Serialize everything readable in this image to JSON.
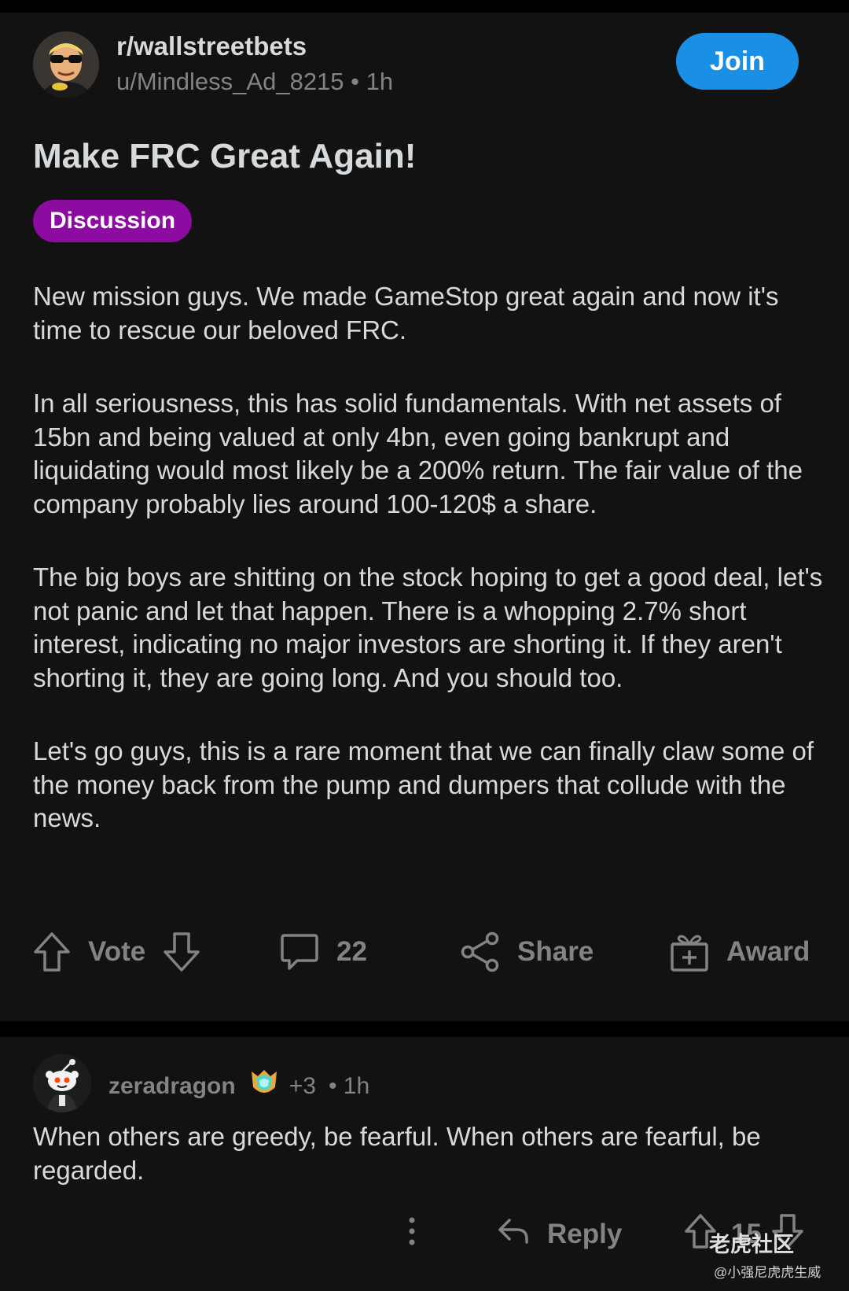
{
  "post": {
    "subreddit": "r/wallstreetbets",
    "author_line": "u/Mindless_Ad_8215 • 1h",
    "join_label": "Join",
    "title": "Make FRC Great Again!",
    "flair": "Discussion",
    "flair_color": "#8c0ba0",
    "paragraphs": [
      "New mission guys. We made GameStop great again and now it's time to rescue our beloved FRC.",
      "In all seriousness, this has solid fundamentals. With net assets of 15bn and being valued at only 4bn, even going bankrupt and liquidating would most likely be a 200% return. The fair value of the company probably lies around 100-120$ a share.",
      "The big boys are shitting on the stock hoping to get a good deal, let's not panic and let that happen. There is a whopping 2.7% short interest, indicating no major investors are shorting it. If they aren't shorting it, they are going long. And you should too.",
      "Let's go guys, this is a rare moment that we can finally claw some of the money back from the pump and dumpers that collude with the news."
    ],
    "actions": {
      "vote_label": "Vote",
      "comment_count": "22",
      "share_label": "Share",
      "award_label": "Award"
    }
  },
  "comment": {
    "username": "zeradragon",
    "award_count": "+3",
    "time": "• 1h",
    "text": "When others are greedy, be fearful. When others are fearful, be regarded.",
    "reply_label": "Reply",
    "score": "15"
  },
  "watermark": {
    "main": "老虎社区",
    "sub": "@小强尼虎虎生威"
  },
  "colors": {
    "background": "#121212",
    "text": "#d7dadc",
    "muted": "#818384",
    "join_button": "#1a8fe6"
  }
}
